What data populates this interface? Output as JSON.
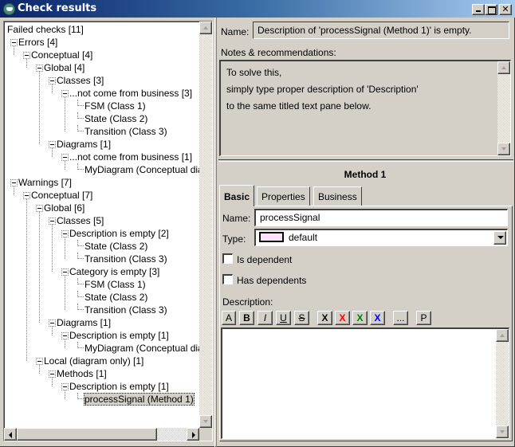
{
  "window": {
    "title": "Check results",
    "controls": [
      "minimize",
      "maximize",
      "close"
    ],
    "close_glyph": "✕"
  },
  "tree": {
    "rows": [
      {
        "label": "Failed checks [11]",
        "level": 0,
        "type": "root"
      },
      {
        "label": "Errors [4]",
        "level": 1,
        "type": "node"
      },
      {
        "label": "Conceptual [4]",
        "level": 2,
        "type": "node"
      },
      {
        "label": "Global [4]",
        "level": 3,
        "type": "node"
      },
      {
        "label": "Classes [3]",
        "level": 4,
        "type": "node"
      },
      {
        "label": "...not come from business [3]",
        "level": 5,
        "type": "node"
      },
      {
        "label": "FSM (Class 1)",
        "level": 6,
        "type": "leaf"
      },
      {
        "label": "State (Class 2)",
        "level": 6,
        "type": "leaf"
      },
      {
        "label": "Transition (Class 3)",
        "level": 6,
        "type": "leaf"
      },
      {
        "label": "Diagrams [1]",
        "level": 4,
        "type": "node"
      },
      {
        "label": "...not come from business [1]",
        "level": 5,
        "type": "node"
      },
      {
        "label": "MyDiagram (Conceptual diagram)",
        "level": 6,
        "type": "leaf"
      },
      {
        "label": "Warnings [7]",
        "level": 1,
        "type": "node"
      },
      {
        "label": "Conceptual [7]",
        "level": 2,
        "type": "node"
      },
      {
        "label": "Global [6]",
        "level": 3,
        "type": "node"
      },
      {
        "label": "Classes [5]",
        "level": 4,
        "type": "node"
      },
      {
        "label": "Description is empty [2]",
        "level": 5,
        "type": "node"
      },
      {
        "label": "State (Class 2)",
        "level": 6,
        "type": "leaf"
      },
      {
        "label": "Transition (Class 3)",
        "level": 6,
        "type": "leaf"
      },
      {
        "label": "Category is empty [3]",
        "level": 5,
        "type": "node"
      },
      {
        "label": "FSM (Class 1)",
        "level": 6,
        "type": "leaf"
      },
      {
        "label": "State (Class 2)",
        "level": 6,
        "type": "leaf"
      },
      {
        "label": "Transition (Class 3)",
        "level": 6,
        "type": "leaf"
      },
      {
        "label": "Diagrams [1]",
        "level": 4,
        "type": "node"
      },
      {
        "label": "Description is empty [1]",
        "level": 5,
        "type": "node"
      },
      {
        "label": "MyDiagram (Conceptual diagram)",
        "level": 6,
        "type": "leaf"
      },
      {
        "label": "Local (diagram only) [1]",
        "level": 3,
        "type": "node"
      },
      {
        "label": "Methods [1]",
        "level": 4,
        "type": "node"
      },
      {
        "label": "Description is empty [1]",
        "level": 5,
        "type": "node"
      },
      {
        "label": "processSignal (Method 1)",
        "level": 6,
        "type": "leaf",
        "selected": true
      }
    ]
  },
  "details": {
    "name_label": "Name:",
    "name_value": "Description of 'processSignal (Method 1)' is empty.",
    "notes_label": "Notes & recommendations:",
    "notes_lines": [
      "To solve this,",
      "simply type proper description of 'Description'",
      "to the same titled text pane below."
    ]
  },
  "editor": {
    "title": "Method 1",
    "tabs": [
      {
        "label": "Basic",
        "active": true
      },
      {
        "label": "Properties",
        "active": false
      },
      {
        "label": "Business",
        "active": false
      }
    ],
    "name_label": "Name:",
    "name_value": "processSignal",
    "type_label": "Type:",
    "type_value": "default",
    "type_swatch_color": "#ffe0ff",
    "checkboxes": [
      {
        "label": "Is dependent",
        "checked": false
      },
      {
        "label": "Has dependents",
        "checked": false
      }
    ],
    "description_label": "Description:",
    "description_value": "",
    "format_buttons": [
      {
        "label": "A",
        "name": "font-button",
        "color": "#000000"
      },
      {
        "label": "B",
        "name": "bold-button",
        "color": "#000000"
      },
      {
        "label": "I",
        "name": "italic-button",
        "color": "#000000"
      },
      {
        "label": "U",
        "name": "underline-button",
        "color": "#000000"
      },
      {
        "label": "S",
        "name": "strikethrough-button",
        "color": "#000000"
      },
      {
        "label": "X",
        "name": "color-black-button",
        "color": "#000000"
      },
      {
        "label": "X",
        "name": "color-red-button",
        "color": "#ff0000"
      },
      {
        "label": "X",
        "name": "color-green-button",
        "color": "#008000"
      },
      {
        "label": "X",
        "name": "color-blue-button",
        "color": "#0000ff"
      },
      {
        "label": "...",
        "name": "more-button",
        "color": "#000000"
      },
      {
        "label": "P",
        "name": "paragraph-button",
        "color": "#000000"
      }
    ]
  }
}
